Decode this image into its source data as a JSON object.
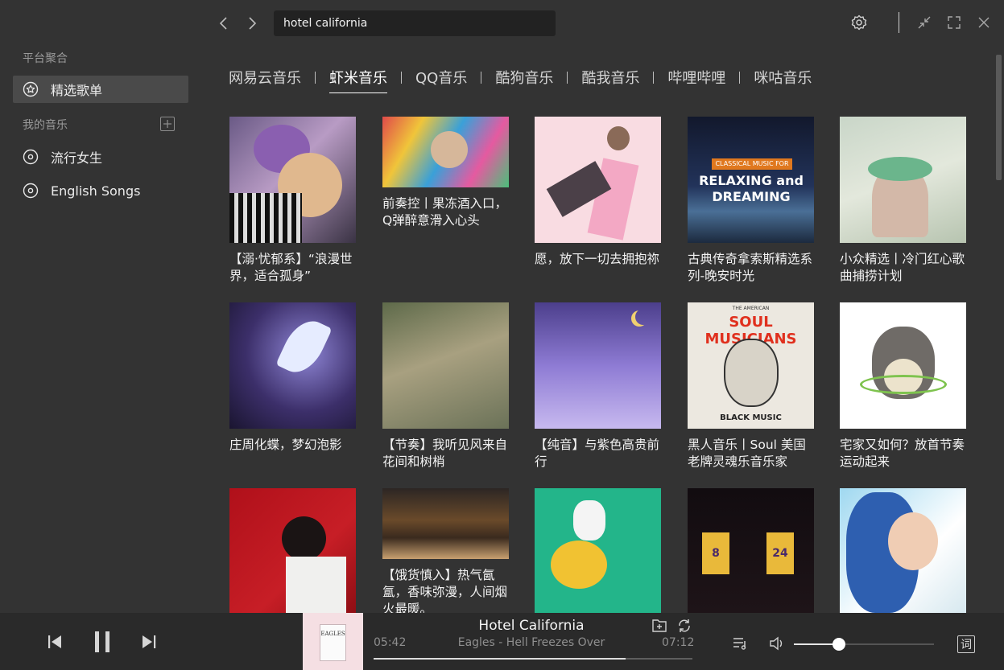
{
  "sidebar": {
    "platform_section": "平台聚合",
    "featured": "精选歌单",
    "my_music_section": "我的音乐",
    "playlists": [
      "流行女生",
      "English Songs"
    ]
  },
  "search": {
    "value": "hotel california"
  },
  "tabs": [
    "网易云音乐",
    "虾米音乐",
    "QQ音乐",
    "酷狗音乐",
    "酷我音乐",
    "哔哩哔哩",
    "咪咕音乐"
  ],
  "active_tab": "虾米音乐",
  "playlists": [
    {
      "title": "【溺·忧郁系】“浪漫世界，适合孤身”"
    },
    {
      "title": "前奏控丨果冻酒入口，Q弹醉意滑入心头"
    },
    {
      "title": "愿，放下一切去拥抱祢"
    },
    {
      "title": "古典传奇拿索斯精选系列-晚安时光",
      "cover_text_top": "CLASSICAL MUSIC FOR",
      "cover_text_main": "RELAXING and DREAMING"
    },
    {
      "title": "小众精选丨冷门红心歌曲捕捞计划"
    },
    {
      "title": "庄周化蝶，梦幻泡影"
    },
    {
      "title": "【节奏】我听见风来自花间和树梢"
    },
    {
      "title": "【纯音】与紫色高贵前行"
    },
    {
      "title": "黑人音乐丨Soul 美国老牌灵魂乐音乐家",
      "cover_text_top": "THE AMERICAN",
      "cover_text_main": "SOUL MUSICIANS",
      "cover_text_bottom": "BLACK MUSIC"
    },
    {
      "title": "宅家又如何？放首节奏运动起来"
    },
    {
      "title": ""
    },
    {
      "title": "【饿货慎入】热气氤氲，香味弥漫，人间烟火最暖。"
    },
    {
      "title": ""
    },
    {
      "title": "",
      "cover_text_jersey": [
        "8",
        "24"
      ]
    },
    {
      "title": ""
    }
  ],
  "player": {
    "title": "Hotel California",
    "artist": "Eagles - Hell Freezes Over",
    "elapsed": "05:42",
    "duration": "07:12",
    "progress": 0.79,
    "volume": 0.32,
    "album_text": "EAGLES",
    "lyric_label": "词"
  },
  "colors": {
    "background": "#333333",
    "player_bg": "#2a2a2a",
    "search_bg": "#222222",
    "active_item": "#4a4a4a"
  }
}
